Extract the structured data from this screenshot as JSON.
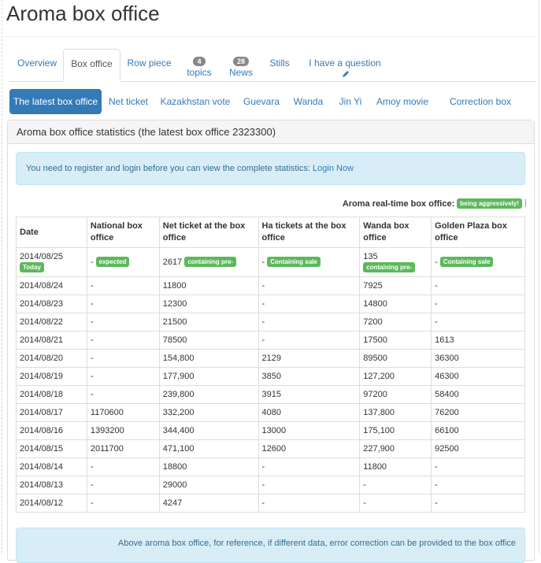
{
  "page": {
    "title": "Aroma box office"
  },
  "tabs": {
    "overview": "Overview",
    "box_office": "Box office",
    "row_piece": "Row piece",
    "topics_count": "4",
    "topics": "topics",
    "news_count": "28",
    "news": "News",
    "stills": "Stills",
    "question": "I have a question"
  },
  "pills": [
    "The latest box office",
    "Net ticket",
    "Kazakhstan vote",
    "Guevara",
    "Wanda",
    "Jin Yi",
    "Amoy movie",
    "Correction box office"
  ],
  "panel": {
    "title": "Aroma box office statistics (the latest box office 2323300)",
    "alert_text": "You need to register and login before you can view the complete statistics: ",
    "alert_link": "Login Now",
    "realtime_label": "Aroma real-time box office:",
    "realtime_badge": "being aggressively!",
    "footer_note": "Above aroma box office, for reference, if different data, error correction can be provided to the box office"
  },
  "table": {
    "headers": [
      "Date",
      "National box office",
      "Net ticket at the box office",
      "Ha tickets at the box office",
      "Wanda box office",
      "Golden Plaza box office"
    ],
    "first_row": {
      "date": "2014/08/25",
      "date_badge": "Today",
      "national": "-",
      "national_badge": "expected",
      "net": "2617",
      "net_badge": "containing pre-",
      "ha": "-",
      "ha_badge": "Containing sale",
      "wanda": "135",
      "wanda_badge": "containing pre-",
      "golden": "-",
      "golden_badge": "Containing sale"
    },
    "rows": [
      [
        "2014/08/24",
        "-",
        "11800",
        "-",
        "7925",
        "-"
      ],
      [
        "2014/08/23",
        "-",
        "12300",
        "-",
        "14800",
        "-"
      ],
      [
        "2014/08/22",
        "-",
        "21500",
        "-",
        "7200",
        "-"
      ],
      [
        "2014/08/21",
        "-",
        "78500",
        "-",
        "17500",
        "1613"
      ],
      [
        "2014/08/20",
        "-",
        "154,800",
        "2129",
        "89500",
        "36300"
      ],
      [
        "2014/08/19",
        "-",
        "177,900",
        "3850",
        "127,200",
        "46300"
      ],
      [
        "2014/08/18",
        "-",
        "239,800",
        "3915",
        "97200",
        "58400"
      ],
      [
        "2014/08/17",
        "1170600",
        "332,200",
        "4080",
        "137,800",
        "76200"
      ],
      [
        "2014/08/16",
        "1393200",
        "344,400",
        "13000",
        "175,100",
        "66100"
      ],
      [
        "2014/08/15",
        "2011700",
        "471,100",
        "12600",
        "227,900",
        "92500"
      ],
      [
        "2014/08/14",
        "-",
        "18800",
        "-",
        "11800",
        "-"
      ],
      [
        "2014/08/13",
        "-",
        "29000",
        "-",
        "-",
        "-"
      ],
      [
        "2014/08/12",
        "-",
        "4247",
        "-",
        "-",
        "-"
      ]
    ]
  },
  "colors": {
    "link": "#337ab7",
    "badge_green": "#5cb85c",
    "badge_gray": "#888888",
    "alert_bg": "#d9edf7"
  }
}
